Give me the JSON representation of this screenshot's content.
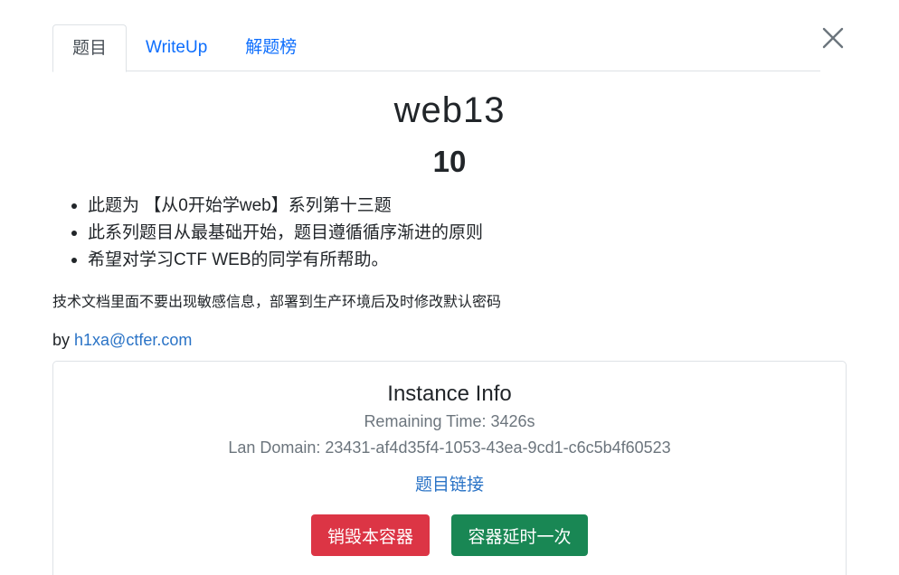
{
  "tabs": [
    {
      "label": "题目",
      "active": true
    },
    {
      "label": "WriteUp",
      "active": false
    },
    {
      "label": "解题榜",
      "active": false
    }
  ],
  "close_icon": "close-icon",
  "challenge": {
    "name": "web13",
    "points": "10",
    "description": [
      "此题为 【从0开始学web】系列第十三题",
      "此系列题目从最基础开始，题目遵循循序渐进的原则",
      "希望对学习CTF WEB的同学有所帮助。"
    ],
    "note": "技术文档里面不要出现敏感信息，部署到生产环境后及时修改默认密码",
    "author_prefix": "by ",
    "author_email": "h1xa@ctfer.com"
  },
  "instance": {
    "title": "Instance Info",
    "remaining_time": "Remaining Time: 3426s",
    "lan_domain": "Lan Domain: 23431-af4d35f4-1053-43ea-9cd1-c6c5b4f60523",
    "link_label": "题目链接",
    "destroy_label": "销毁本容器",
    "extend_label": "容器延时一次"
  },
  "colors": {
    "link": "#2a73c6",
    "danger": "#dc3545",
    "success": "#198754",
    "muted": "#6c757d"
  }
}
